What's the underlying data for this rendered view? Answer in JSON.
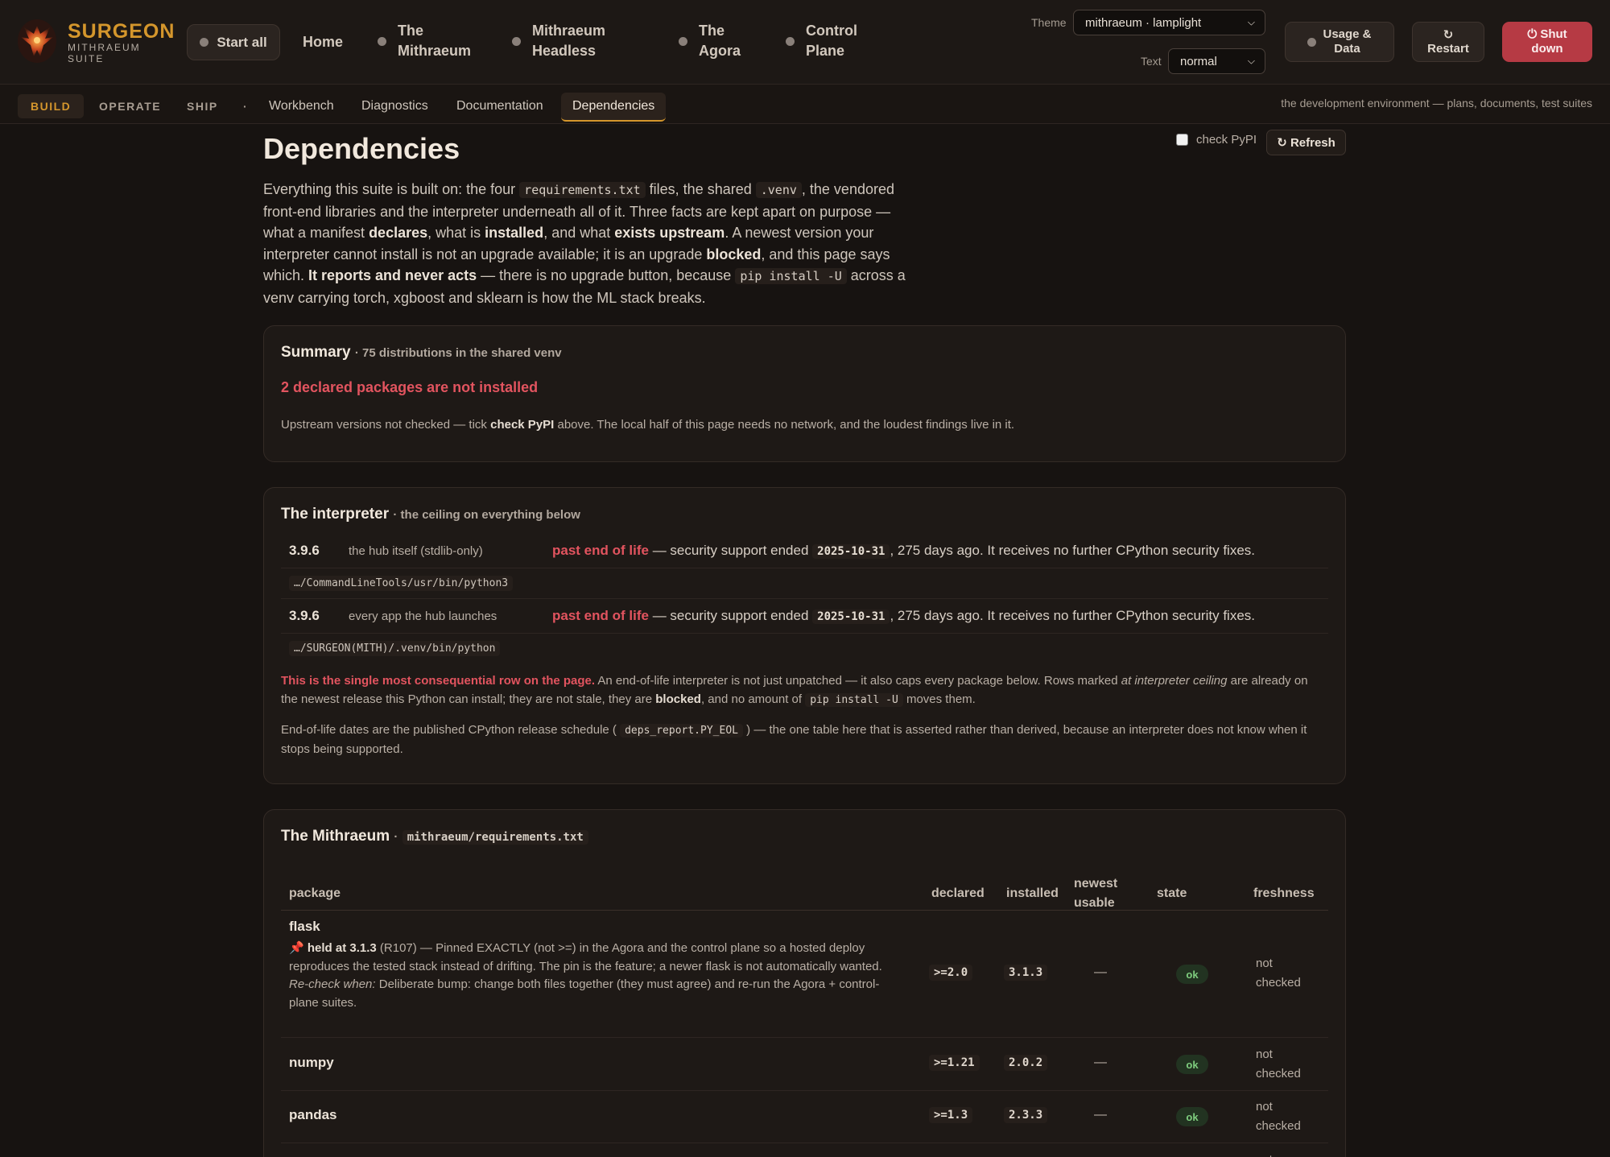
{
  "brand": {
    "name": "SURGEON",
    "sub1": "MITHRAEUM",
    "sub2": "SUITE"
  },
  "topnav": {
    "start_all": "Start all",
    "home": "Home",
    "items": [
      {
        "l1": "The",
        "l2": "Mithraeum"
      },
      {
        "l1": "Mithraeum",
        "l2": "Headless"
      },
      {
        "l1": "The",
        "l2": "Agora"
      },
      {
        "l1": "Control",
        "l2": "Plane"
      }
    ],
    "theme_label": "Theme",
    "theme_value": "mithraeum · lamplight",
    "text_label": "Text",
    "text_value": "normal",
    "usage_l1": "Usage &",
    "usage_l2": "Data",
    "restart_icon": "↻",
    "restart": "Restart",
    "shutdown_l1": "⏻ Shut",
    "shutdown_l2": "down"
  },
  "subnav": {
    "modes": [
      "BUILD",
      "OPERATE",
      "SHIP"
    ],
    "separator": "·",
    "tabs": [
      "Workbench",
      "Diagnostics",
      "Documentation",
      "Dependencies"
    ],
    "note": "the development environment — plans, documents, test suites"
  },
  "page": {
    "title": "Dependencies",
    "check_pypi": "check PyPI",
    "refresh": "↻ Refresh"
  },
  "intro": {
    "p1": "Everything this suite is built on: the four ",
    "c1": "requirements.txt",
    "p2": " files, the shared ",
    "c2": ".venv",
    "p3": ", the vendored front-end libraries and the interpreter underneath all of it. Three facts are kept apart on purpose — what a manifest ",
    "b1": "declares",
    "p4": ", what is ",
    "b2": "installed",
    "p5": ", and what ",
    "b3": "exists upstream",
    "p6": ". A newest version your interpreter cannot install is not an upgrade available; it is an upgrade ",
    "b4": "blocked",
    "p7": ", and this page says which. ",
    "b5": "It reports and never acts",
    "p8": " — there is no upgrade button, because ",
    "c3": "pip install -U",
    "p9": " across a venv carrying torch, xgboost and sklearn is how the ML stack breaks."
  },
  "summary": {
    "title": "Summary",
    "sub": "· 75 distributions in the shared venv",
    "alert": "2 declared packages are not installed",
    "note_a": "Upstream versions not checked — tick ",
    "note_b": "check PyPI",
    "note_c": " above. The local half of this page needs no network, and the loudest findings live in it."
  },
  "interpreter": {
    "title": "The interpreter",
    "sub": "· the ceiling on everything below",
    "rows": [
      {
        "version": "3.9.6",
        "desc": "the hub itself (stdlib-only)",
        "status": "past end of life",
        "mid": " — security support ended ",
        "date": "2025-10-31",
        "tail": ", 275 days ago. It receives no further CPython security fixes.",
        "path": "…/CommandLineTools/usr/bin/python3"
      },
      {
        "version": "3.9.6",
        "desc": "every app the hub launches",
        "status": "past end of life",
        "mid": " — security support ended ",
        "date": "2025-10-31",
        "tail": ", 275 days ago. It receives no further CPython security fixes.",
        "path": "…/SURGEON(MITH)/.venv/bin/python"
      }
    ],
    "note1_a": "This is the single most consequential row on the page.",
    "note1_b": " An end-of-life interpreter is not just unpatched — it also caps every package below. Rows marked ",
    "note1_c": "at interpreter ceiling",
    "note1_d": " are already on the newest release this Python can install; they are not stale, they are ",
    "note1_e": "blocked",
    "note1_f": ", and no amount of ",
    "note1_g": "pip install -U",
    "note1_h": " moves them.",
    "note2_a": "End-of-life dates are the published CPython release schedule ( ",
    "note2_b": "deps_report.PY_EOL",
    "note2_c": " ) — the one table here that is asserted rather than derived, because an interpreter does not know when it stops being supported."
  },
  "mithraeum": {
    "title": "The Mithraeum",
    "dot": "·",
    "file": "mithraeum/requirements.txt",
    "headers": {
      "package": "package",
      "declared": "declared",
      "installed": "installed",
      "newest_l1": "newest",
      "newest_l2": "usable",
      "state": "state",
      "freshness": "freshness"
    },
    "rows": [
      {
        "package": "flask",
        "held": "held at 3.1.3",
        "held_tail": " (R107) — Pinned EXACTLY (not >=) in the Agora and the control plane so a hosted deploy reproduces the tested stack instead of drifting. The pin is the feature; a newer flask is not automatically wanted.",
        "recheck_label": "Re-check when:",
        "recheck_text": " Deliberate bump: change both files together (they must agree) and re-run the Agora + control-plane suites.",
        "declared": ">=2.0",
        "installed": "3.1.3",
        "newest": "—",
        "state": "ok",
        "fresh_l1": "not",
        "fresh_l2": "checked"
      },
      {
        "package": "numpy",
        "declared": ">=1.21",
        "installed": "2.0.2",
        "newest": "—",
        "state": "ok",
        "fresh_l1": "not",
        "fresh_l2": "checked"
      },
      {
        "package": "pandas",
        "declared": ">=1.3",
        "installed": "2.3.3",
        "newest": "—",
        "state": "ok",
        "fresh_l1": "not",
        "fresh_l2": "checked"
      },
      {
        "fresh_l1": "not"
      }
    ]
  },
  "colors": {
    "accent": "#d4962c",
    "danger": "#e2545f",
    "ok": "#7fce7f",
    "background": "#171311"
  }
}
